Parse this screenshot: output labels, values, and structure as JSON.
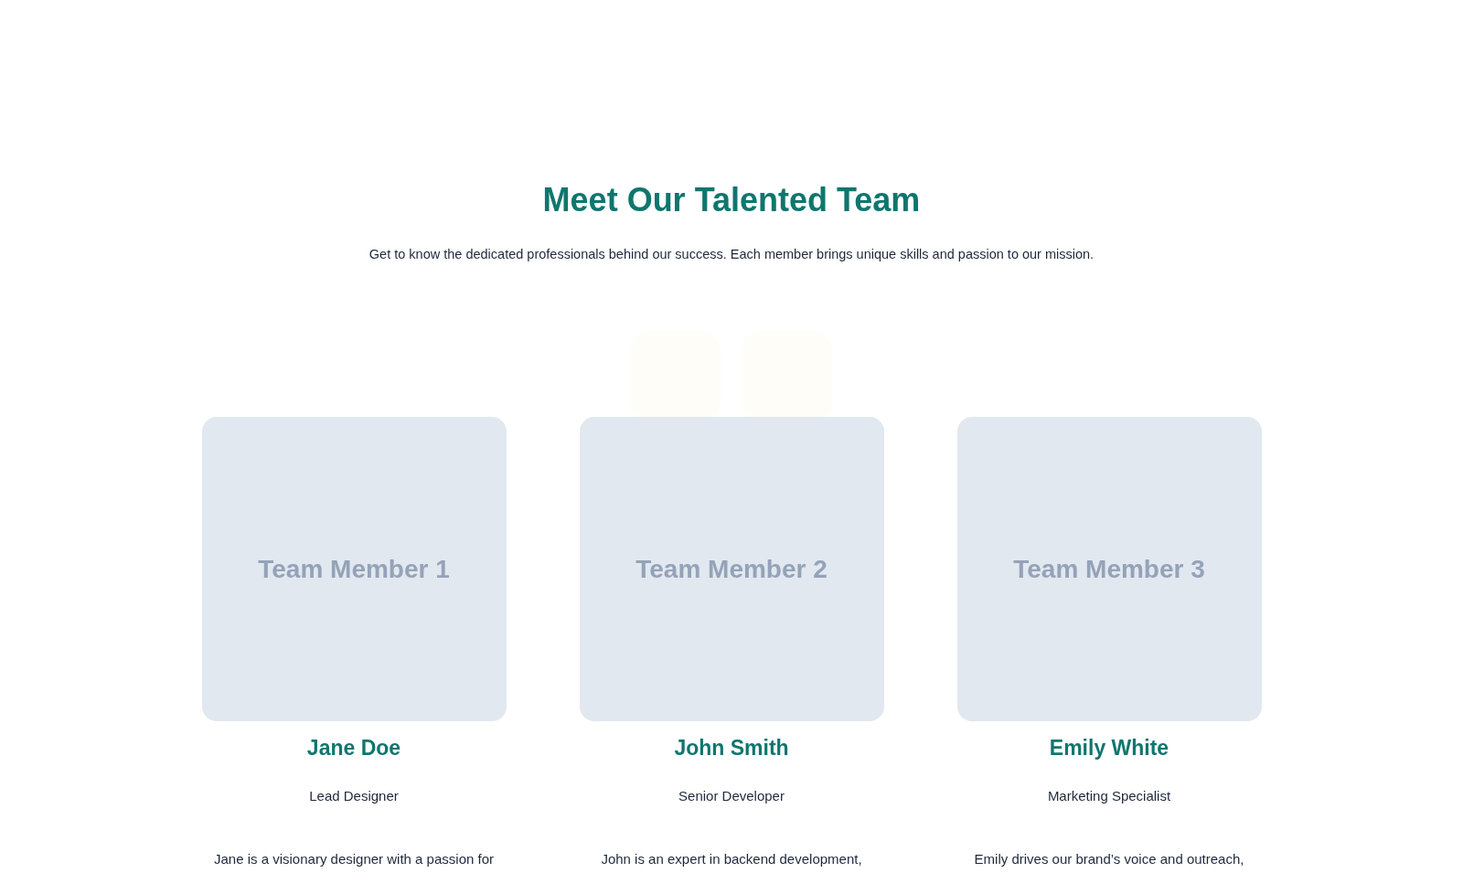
{
  "header": {
    "title": "Meet Our Talented Team",
    "subtitle": "Get to know the dedicated professionals behind our success. Each member brings unique skills and passion to our mission."
  },
  "members": [
    {
      "photo_label": "Team Member 1",
      "name": "Jane Doe",
      "role": "Lead Designer",
      "bio": "Jane is a visionary designer with a passion for"
    },
    {
      "photo_label": "Team Member 2",
      "name": "John Smith",
      "role": "Senior Developer",
      "bio": "John is an expert in backend development,"
    },
    {
      "photo_label": "Team Member 3",
      "name": "Emily White",
      "role": "Marketing Specialist",
      "bio": "Emily drives our brand’s voice and outreach,"
    }
  ]
}
